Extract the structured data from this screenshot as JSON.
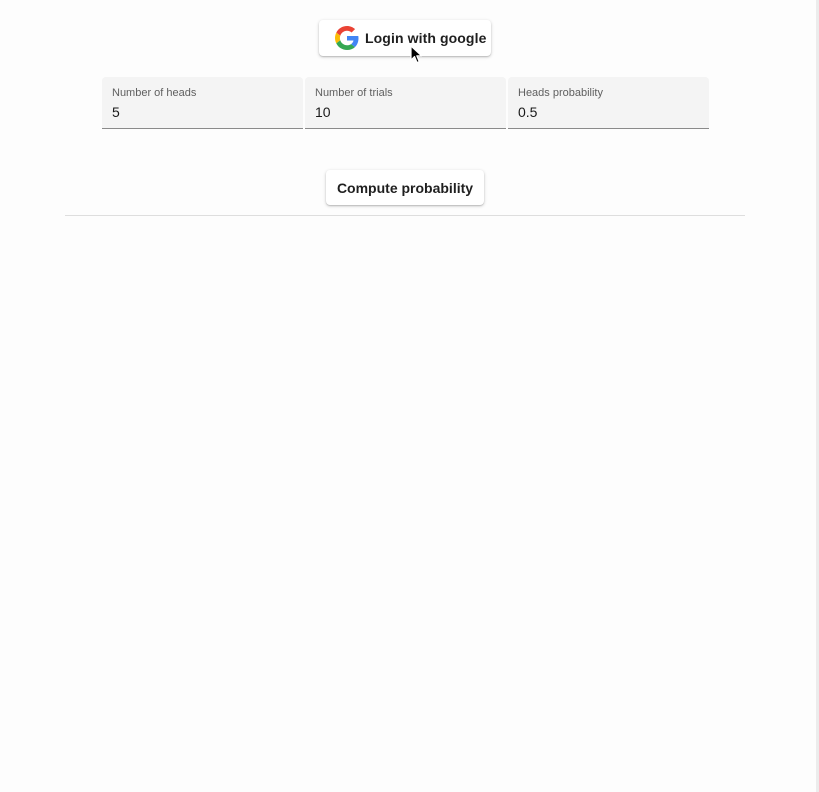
{
  "login": {
    "label": "Login with google",
    "icon": "google-g-icon"
  },
  "fields": [
    {
      "label": "Number of heads",
      "value": "5"
    },
    {
      "label": "Number of trials",
      "value": "10"
    },
    {
      "label": "Heads probability",
      "value": "0.5"
    }
  ],
  "compute": {
    "label": "Compute probability"
  },
  "colors": {
    "background": "#fdfdfd",
    "field_background": "#f4f4f4",
    "google_blue": "#4285F4",
    "google_red": "#EA4335",
    "google_yellow": "#FBBC05",
    "google_green": "#34A853"
  }
}
